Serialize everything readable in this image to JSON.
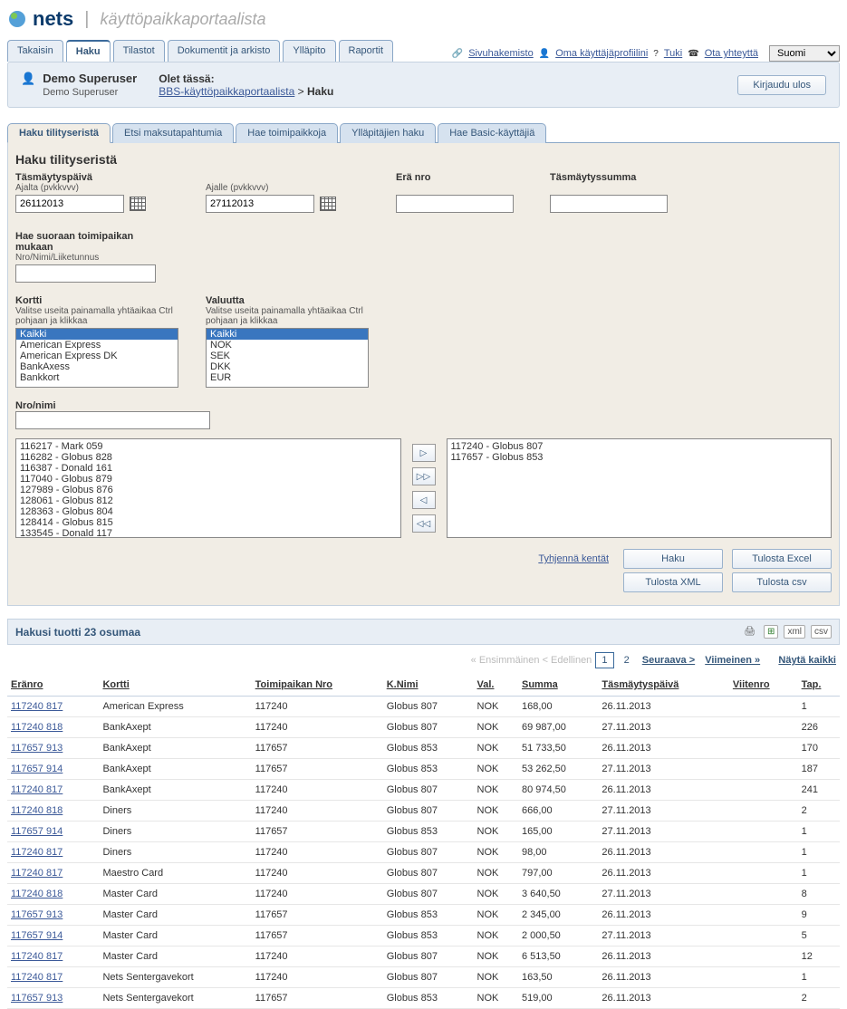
{
  "brand": {
    "name": "nets",
    "subtitle": "käyttöpaikkaportaalista"
  },
  "topnav": {
    "tabs": [
      "Takaisin",
      "Haku",
      "Tilastot",
      "Dokumentit ja arkisto",
      "Ylläpito",
      "Raportit"
    ],
    "active": 1,
    "links": {
      "sitemap": "Sivuhakemisto",
      "profile": "Oma käyttäjäprofiilini",
      "help": "Tuki",
      "contact": "Ota yhteyttä"
    },
    "lang": "Suomi"
  },
  "user": {
    "name": "Demo Superuser",
    "role": "Demo Superuser",
    "bc_label": "Olet tässä:",
    "bc_link": "BBS-käyttöpaikkaportaalista",
    "bc_sep": ">",
    "bc_current": "Haku",
    "logout": "Kirjaudu ulos"
  },
  "subtabs": {
    "items": [
      "Haku tilityseristä",
      "Etsi maksutapahtumia",
      "Hae toimipaikkoja",
      "Ylläpitäjien haku",
      "Hae Basic-käyttäjiä"
    ],
    "active": 0
  },
  "search": {
    "title": "Haku tilityseristä",
    "fields": {
      "settle_date": "Täsmäytyspäivä",
      "from": "Ajalta (pvkkvvv)",
      "to": "Ajalle (pvkkvvv)",
      "from_val": "26112013",
      "to_val": "27112013",
      "batch": "Erä nro",
      "amount": "Täsmäytyssumma",
      "direct": "Hae suoraan toimipaikan mukaan",
      "direct_sub": "Nro/Nimi/Liiketunnus",
      "card": "Kortti",
      "multi_hint": "Valitse useita painamalla yhtäaikaa Ctrl pohjaan ja klikkaa",
      "currency": "Valuutta",
      "nroname": "Nro/nimi"
    },
    "card_options": [
      "Kaikki",
      "American Express",
      "American Express DK",
      "BankAxess",
      "Bankkort"
    ],
    "currency_options": [
      "Kaikki",
      "NOK",
      "SEK",
      "DKK",
      "EUR"
    ],
    "left_list": [
      "116217 - Mark 059",
      "116282 - Globus 828",
      "116387 - Donald 161",
      "117040 - Globus 879",
      "127989 - Globus 876",
      "128061 - Globus 812",
      "128363 - Globus 804",
      "128414 - Globus 815",
      "133545 - Donald 117"
    ],
    "right_list": [
      "117240 - Globus 807",
      "117657 - Globus 853"
    ],
    "actions": {
      "clear": "Tyhjennä kentät",
      "search": "Haku",
      "excel": "Tulosta Excel",
      "xml": "Tulosta XML",
      "csv": "Tulosta csv"
    }
  },
  "results": {
    "summary": "Hakusi tuotti 23 osumaa",
    "export": {
      "xml": "xml",
      "csv": "csv"
    },
    "pagination": {
      "first": "« Ensimmäinen",
      "prev": "< Edellinen",
      "pages": [
        "1",
        "2"
      ],
      "next": "Seuraava >",
      "last": "Viimeinen »",
      "showall": "Näytä kaikki"
    },
    "headers": {
      "batch": "Eränro",
      "card": "Kortti",
      "merchant": "Toimipaikan Nro",
      "kname": "K.Nimi",
      "val": "Val.",
      "sum": "Summa",
      "date": "Täsmäytyspäivä",
      "ref": "Viitenro",
      "tap": "Tap."
    },
    "rows": [
      {
        "b": "117240 817",
        "c": "American Express",
        "m": "117240",
        "k": "Globus 807",
        "v": "NOK",
        "s": "168,00",
        "d": "26.11.2013",
        "r": "",
        "t": "1"
      },
      {
        "b": "117240 818",
        "c": "BankAxept",
        "m": "117240",
        "k": "Globus 807",
        "v": "NOK",
        "s": "69 987,00",
        "d": "27.11.2013",
        "r": "",
        "t": "226"
      },
      {
        "b": "117657 913",
        "c": "BankAxept",
        "m": "117657",
        "k": "Globus 853",
        "v": "NOK",
        "s": "51 733,50",
        "d": "26.11.2013",
        "r": "",
        "t": "170"
      },
      {
        "b": "117657 914",
        "c": "BankAxept",
        "m": "117657",
        "k": "Globus 853",
        "v": "NOK",
        "s": "53 262,50",
        "d": "27.11.2013",
        "r": "",
        "t": "187"
      },
      {
        "b": "117240 817",
        "c": "BankAxept",
        "m": "117240",
        "k": "Globus 807",
        "v": "NOK",
        "s": "80 974,50",
        "d": "26.11.2013",
        "r": "",
        "t": "241"
      },
      {
        "b": "117240 818",
        "c": "Diners",
        "m": "117240",
        "k": "Globus 807",
        "v": "NOK",
        "s": "666,00",
        "d": "27.11.2013",
        "r": "",
        "t": "2"
      },
      {
        "b": "117657 914",
        "c": "Diners",
        "m": "117657",
        "k": "Globus 853",
        "v": "NOK",
        "s": "165,00",
        "d": "27.11.2013",
        "r": "",
        "t": "1"
      },
      {
        "b": "117240 817",
        "c": "Diners",
        "m": "117240",
        "k": "Globus 807",
        "v": "NOK",
        "s": "98,00",
        "d": "26.11.2013",
        "r": "",
        "t": "1"
      },
      {
        "b": "117240 817",
        "c": "Maestro Card",
        "m": "117240",
        "k": "Globus 807",
        "v": "NOK",
        "s": "797,00",
        "d": "26.11.2013",
        "r": "",
        "t": "1"
      },
      {
        "b": "117240 818",
        "c": "Master Card",
        "m": "117240",
        "k": "Globus 807",
        "v": "NOK",
        "s": "3 640,50",
        "d": "27.11.2013",
        "r": "",
        "t": "8"
      },
      {
        "b": "117657 913",
        "c": "Master Card",
        "m": "117657",
        "k": "Globus 853",
        "v": "NOK",
        "s": "2 345,00",
        "d": "26.11.2013",
        "r": "",
        "t": "9"
      },
      {
        "b": "117657 914",
        "c": "Master Card",
        "m": "117657",
        "k": "Globus 853",
        "v": "NOK",
        "s": "2 000,50",
        "d": "27.11.2013",
        "r": "",
        "t": "5"
      },
      {
        "b": "117240 817",
        "c": "Master Card",
        "m": "117240",
        "k": "Globus 807",
        "v": "NOK",
        "s": "6 513,50",
        "d": "26.11.2013",
        "r": "",
        "t": "12"
      },
      {
        "b": "117240 817",
        "c": "Nets Sentergavekort",
        "m": "117240",
        "k": "Globus 807",
        "v": "NOK",
        "s": "163,50",
        "d": "26.11.2013",
        "r": "",
        "t": "1"
      },
      {
        "b": "117657 913",
        "c": "Nets Sentergavekort",
        "m": "117657",
        "k": "Globus 853",
        "v": "NOK",
        "s": "519,00",
        "d": "26.11.2013",
        "r": "",
        "t": "2"
      }
    ]
  }
}
